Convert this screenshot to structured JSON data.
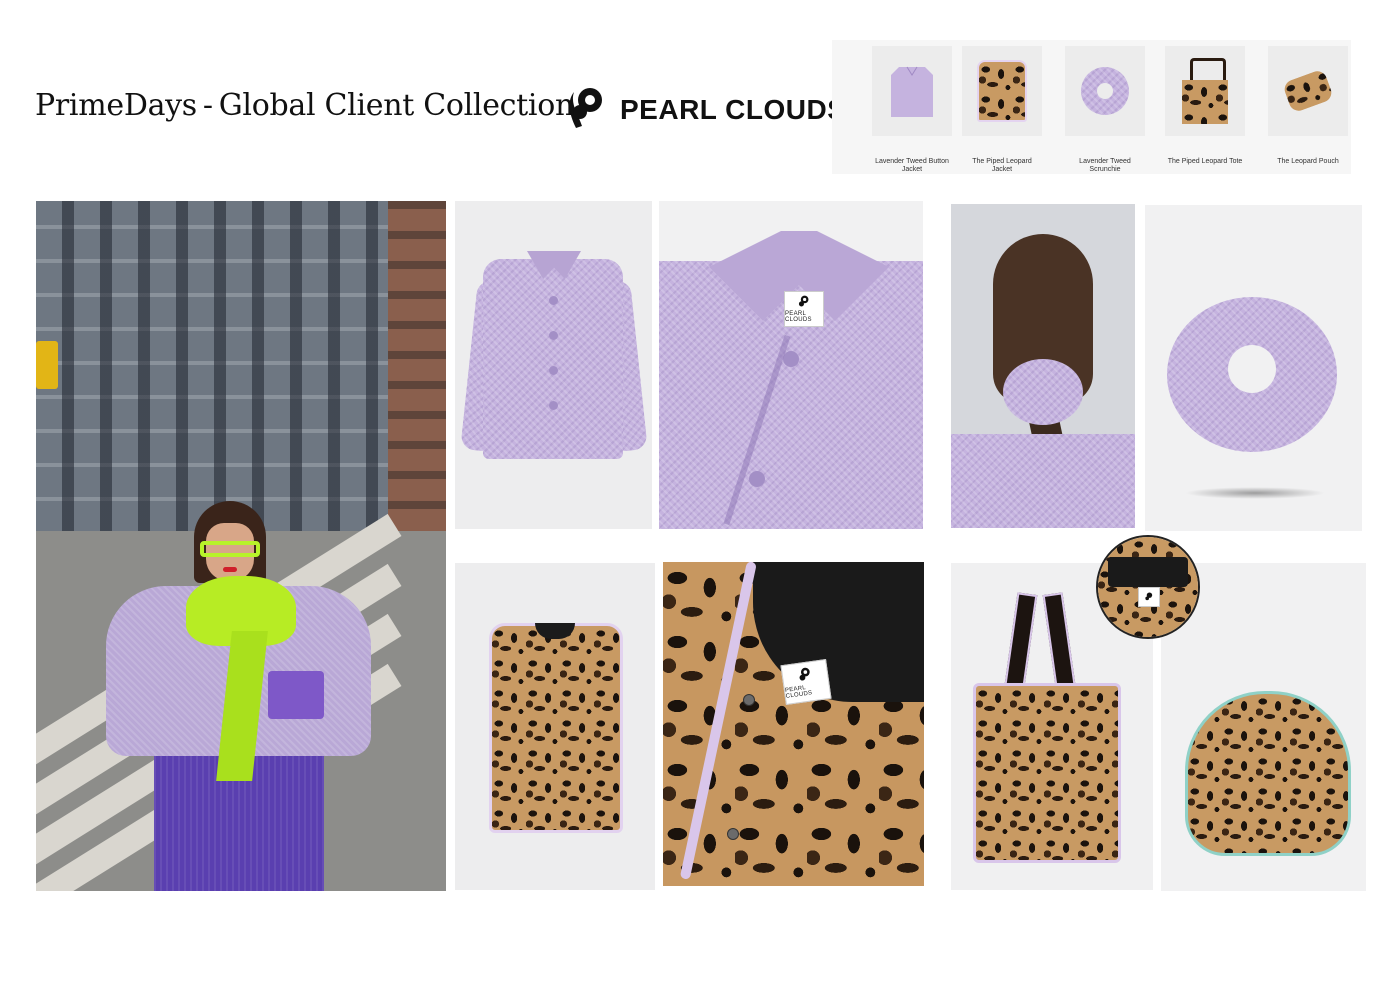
{
  "header": {
    "title_part1": "PrimeDays",
    "separator": "-",
    "title_part2": "Global Client Collection",
    "brand_name": "PEARL CLOUDS"
  },
  "product_strip": [
    {
      "label": "Lavender Tweed Button Jacket",
      "icon": "lavender-jacket-thumb"
    },
    {
      "label": "The Piped Leopard Jacket",
      "icon": "leopard-jacket-thumb"
    },
    {
      "label": "Lavender Tweed Scrunchie",
      "icon": "scrunchie-thumb"
    },
    {
      "label": "The Piped Leopard Tote",
      "icon": "leopard-tote-thumb"
    },
    {
      "label": "The Leopard Pouch",
      "icon": "leopard-pouch-thumb"
    }
  ],
  "tag_text": "PEARL CLOUDS",
  "colors": {
    "lavender": "#c5b3df",
    "neon_green": "#b7ec24",
    "leopard_base": "#c89a63",
    "tile_grey": "#ededee",
    "piping": "#d9c6ea",
    "pouch_zip": "#8fd1c7"
  }
}
